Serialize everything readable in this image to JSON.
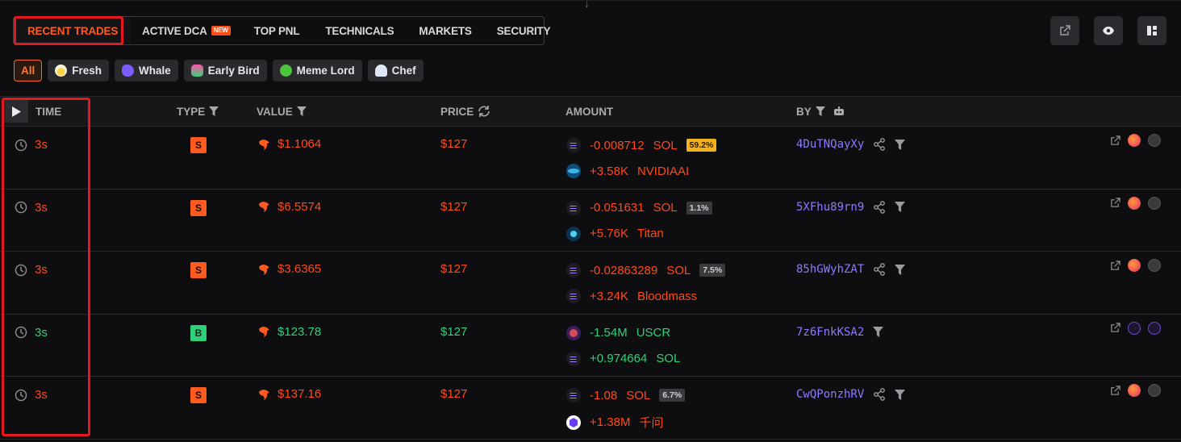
{
  "tabs": [
    {
      "label": "RECENT TRADES",
      "active": true
    },
    {
      "label": "ACTIVE DCA",
      "badge": "NEW"
    },
    {
      "label": "TOP PNL"
    },
    {
      "label": "TECHNICALS"
    },
    {
      "label": "MARKETS"
    },
    {
      "label": "SECURITY"
    }
  ],
  "toolbar_icons": [
    "external-link-icon",
    "eye-icon",
    "layout-icon"
  ],
  "filters": [
    {
      "label": "All",
      "active": true
    },
    {
      "label": "Fresh",
      "icon": "egg-icon"
    },
    {
      "label": "Whale",
      "icon": "whale-icon"
    },
    {
      "label": "Early Bird",
      "icon": "bird-icon"
    },
    {
      "label": "Meme Lord",
      "icon": "frog-icon"
    },
    {
      "label": "Chef",
      "icon": "chef-hat-icon"
    }
  ],
  "columns": {
    "time": "TIME",
    "type": "TYPE",
    "value": "VALUE",
    "price": "PRICE",
    "amount": "AMOUNT",
    "by": "BY"
  },
  "rows": [
    {
      "time": "3s",
      "type": "S",
      "value": "$1.1064",
      "price": "$127",
      "amount1": "-0.008712",
      "token1": "SOL",
      "pct": "59.2%",
      "amount2": "+3.58K",
      "token2": "NVIDIAAI",
      "by": "4DuTNQayXy"
    },
    {
      "time": "3s",
      "type": "S",
      "value": "$6.5574",
      "price": "$127",
      "amount1": "-0.051631",
      "token1": "SOL",
      "pct": "1.1%",
      "amount2": "+5.76K",
      "token2": "Titan",
      "by": "5XFhu89rn9"
    },
    {
      "time": "3s",
      "type": "S",
      "value": "$3.6365",
      "price": "$127",
      "amount1": "-0.02863289",
      "token1": "SOL",
      "pct": "7.5%",
      "amount2": "+3.24K",
      "token2": "Bloodmass",
      "by": "85hGWyhZAT"
    },
    {
      "time": "3s",
      "type": "B",
      "value": "$123.78",
      "price": "$127",
      "amount1": "-1.54M",
      "token1": "USCR",
      "pct": "",
      "amount2": "+0.974664",
      "token2": "SOL",
      "by": "7z6FnkKSA2"
    },
    {
      "time": "3s",
      "type": "S",
      "value": "$137.16",
      "price": "$127",
      "amount1": "-1.08",
      "token1": "SOL",
      "pct": "6.7%",
      "amount2": "+1.38M",
      "token2": "千问",
      "by": "CwQPonzhRV"
    }
  ],
  "colors": {
    "sell": "#ff4a1a",
    "buy": "#2fd07a",
    "accent": "#ff5a1f",
    "wallet": "#8a7bff",
    "highlight": "#e4181f"
  }
}
